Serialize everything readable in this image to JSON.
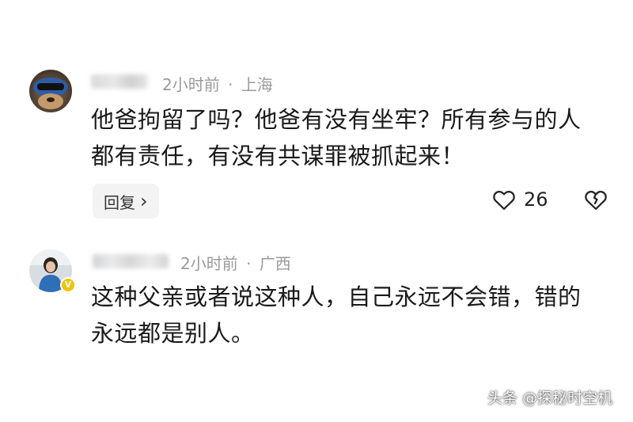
{
  "comments": [
    {
      "time": "2小时前",
      "separator": "·",
      "location": "上海",
      "text": "他爸拘留了吗？他爸有没有坐牢？所有参与的人都有责任，有没有共谋罪被抓起来！",
      "reply_label": "回复",
      "reply_chevron": "›",
      "likes": "26",
      "like_icon": "heart-outline-icon",
      "dislike_icon": "broken-heart-icon"
    },
    {
      "time": "2小时前",
      "separator": "·",
      "location": "广西",
      "text": "这种父亲或者说这种人，自己永远不会错，错的永远都是别人。",
      "badge": "V"
    }
  ],
  "watermark": "头条 @探秘时空机",
  "colors": {
    "meta": "#9a9a9a",
    "reply_bg": "#f3f3f3",
    "badge": "#f2c200"
  }
}
